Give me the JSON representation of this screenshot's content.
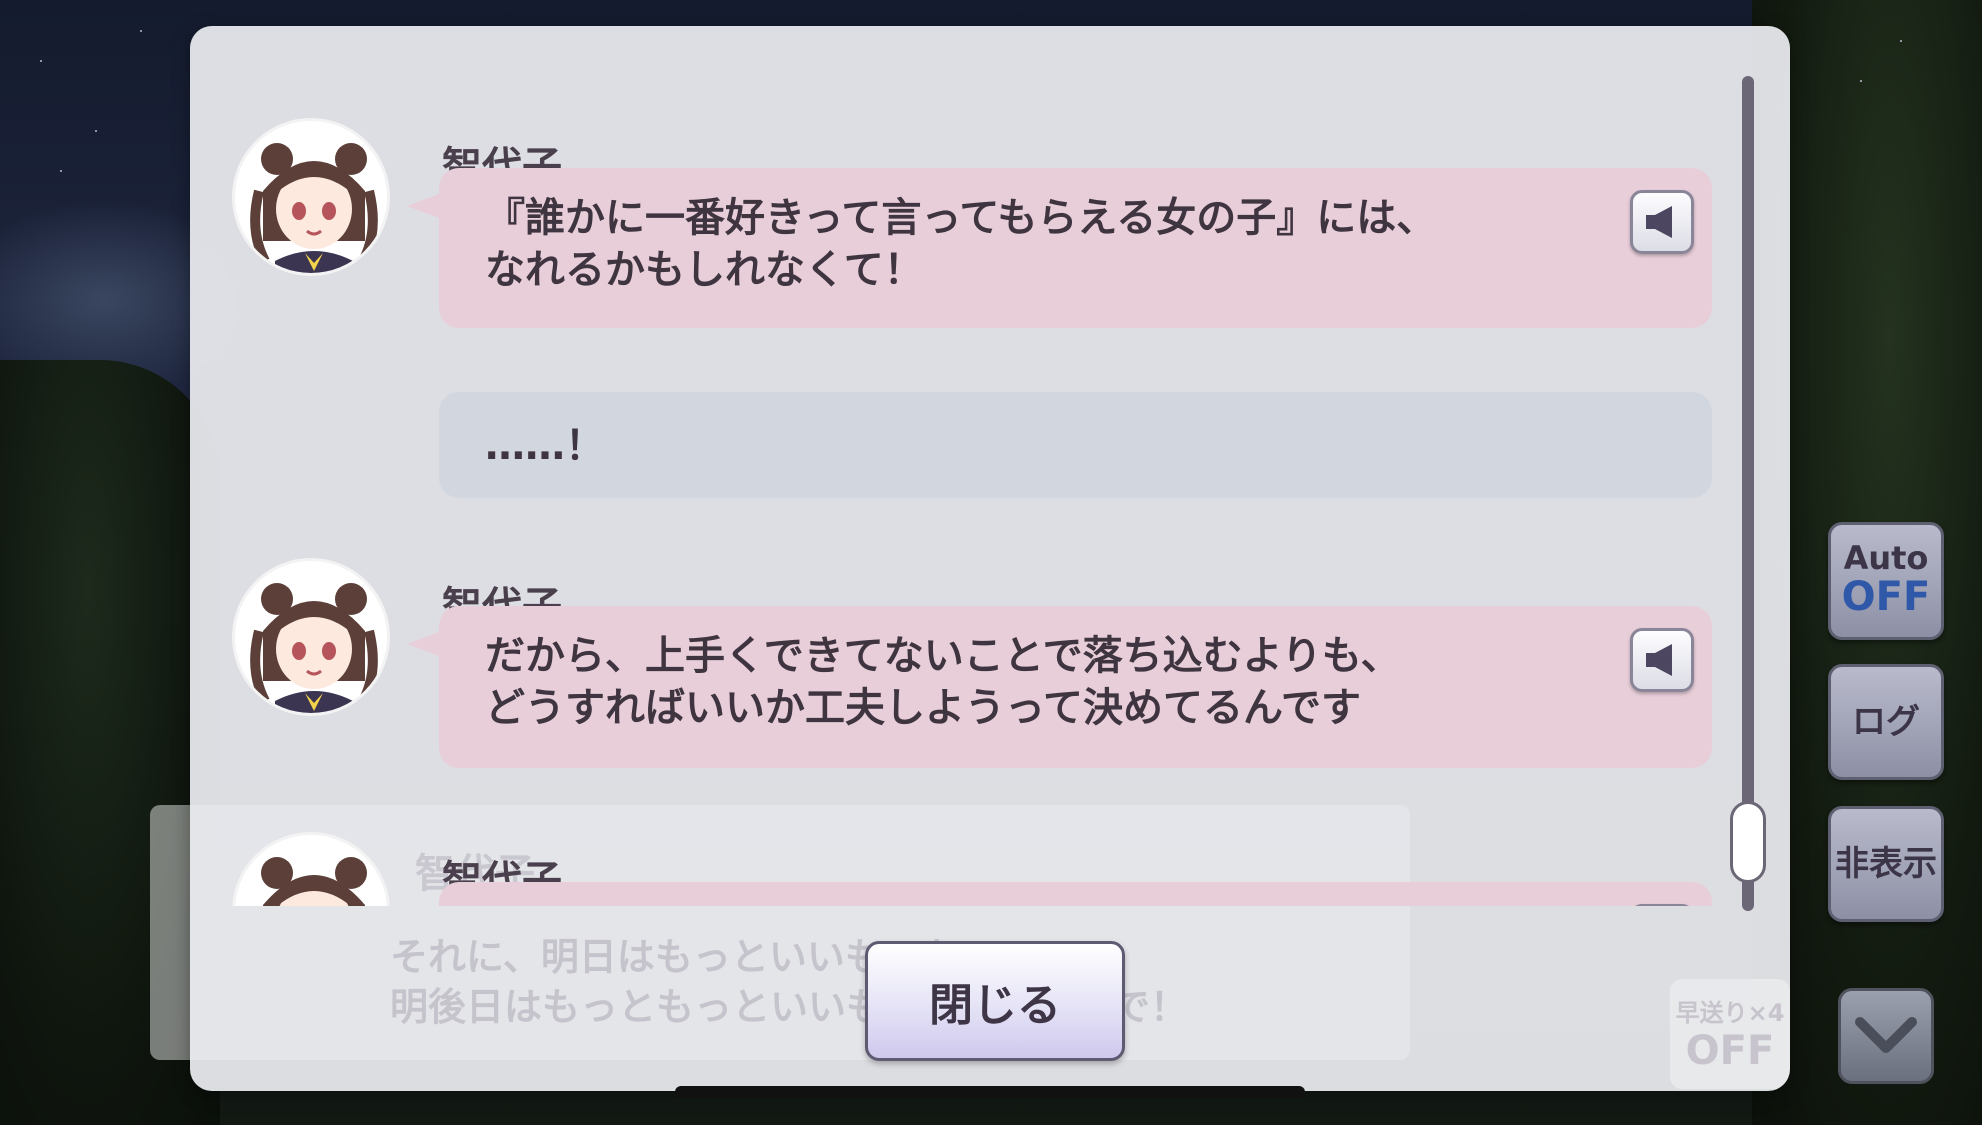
{
  "log_entries": [
    {
      "speaker": "智代子",
      "text": "『誰かに一番好きって言ってもらえる女の子』には、\nなれるかもしれなくて！",
      "has_voice": true
    },
    {
      "speaker": "",
      "text": "……！",
      "has_voice": false
    },
    {
      "speaker": "智代子",
      "text": "だから、上手くできてないことで落ち込むよりも、\nどうすればいいか工夫しようって決めてるんです",
      "has_voice": true
    },
    {
      "speaker": "智代子",
      "text": "",
      "has_voice": true
    }
  ],
  "close_button": {
    "label": "閉じる"
  },
  "side_buttons": {
    "auto_label": "Auto",
    "auto_state": "OFF",
    "log_label": "ログ",
    "hide_label": "非表示"
  },
  "background_dialog": {
    "speaker": "智代子",
    "line1": "それに、明日はもっといいものを、",
    "line2": "明後日はもっともっといいものにしたいので！",
    "fast_forward_label": "早送り×4",
    "fast_forward_state": "OFF"
  },
  "colors": {
    "speech_bubble": "#e8ced9",
    "narration_bubble": "#d2d6de",
    "auto_off_text": "#2f58a8"
  },
  "icons": {
    "voice": "speaker-icon",
    "down": "chevron-down-icon",
    "avatar": "character-avatar"
  }
}
